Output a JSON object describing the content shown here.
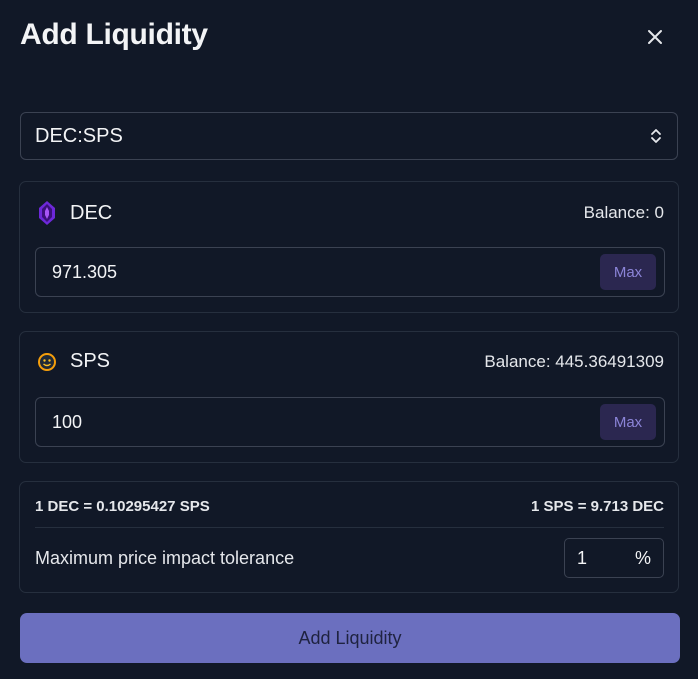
{
  "dialog": {
    "title": "Add Liquidity",
    "close_icon": "close-icon"
  },
  "pair_select": {
    "value": "DEC:SPS",
    "icon": "chevron-up-down-icon"
  },
  "token_a": {
    "symbol": "DEC",
    "icon": "dec-token-icon",
    "balance_label": "Balance: 0",
    "amount": "971.305",
    "max_label": "Max"
  },
  "token_b": {
    "symbol": "SPS",
    "icon": "sps-token-icon",
    "balance_label": "Balance: 445.36491309",
    "amount": "100",
    "max_label": "Max"
  },
  "rates": {
    "a_to_b": "1 DEC = 0.10295427 SPS",
    "b_to_a": "1 SPS = 9.713 DEC"
  },
  "tolerance": {
    "label": "Maximum price impact tolerance",
    "value": "1",
    "unit": "%"
  },
  "submit": {
    "label": "Add Liquidity"
  },
  "colors": {
    "background": "#111827",
    "accent": "#6b6fbf",
    "max_button_bg": "#2b2750",
    "max_button_text": "#8b84d8"
  }
}
